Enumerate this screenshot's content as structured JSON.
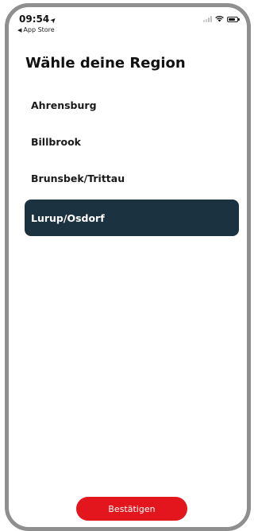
{
  "status_bar": {
    "time": "09:54",
    "back_label": "App Store"
  },
  "page": {
    "title": "Wähle deine Region"
  },
  "regions": [
    {
      "label": "Ahrensburg",
      "selected": false
    },
    {
      "label": "Billbrook",
      "selected": false
    },
    {
      "label": "Brunsbek/Trittau",
      "selected": false
    },
    {
      "label": "Lurup/Osdorf",
      "selected": true
    }
  ],
  "footer": {
    "confirm_label": "Bestätigen"
  },
  "colors": {
    "selected_bg": "#1b3340",
    "confirm_bg": "#e3161d"
  },
  "icons": {
    "location": "location-arrow-icon",
    "back": "back-triangle-icon",
    "signal": "cellular-signal-icon",
    "wifi": "wifi-icon",
    "battery": "battery-icon"
  }
}
